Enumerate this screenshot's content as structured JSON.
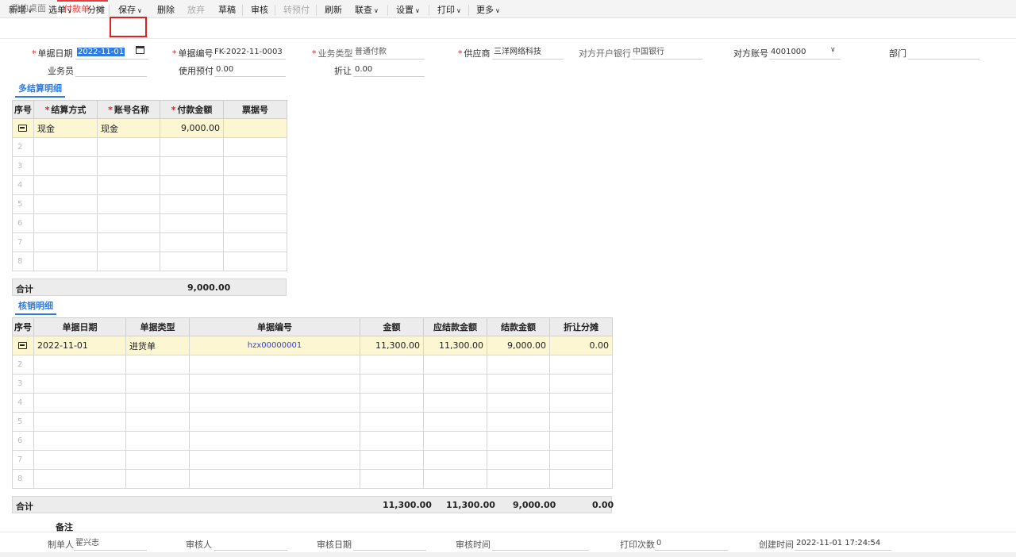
{
  "tabs": {
    "home": "我的桌面",
    "active": "付款单",
    "close": "×"
  },
  "toolbar": {
    "new": "新增",
    "select": "选单",
    "split": "分摊",
    "save": "保存",
    "delete": "删除",
    "abandon": "放弃",
    "draft": "草稿",
    "audit": "审核",
    "to_prepay": "转预付",
    "refresh": "刷新",
    "linked_query": "联查",
    "settings": "设置",
    "print": "打印",
    "more": "更多"
  },
  "form": {
    "doc_date_label": "单据日期",
    "doc_date": "2022-11-01",
    "doc_no_label": "单据编号",
    "doc_no": "FK-2022-11-0003",
    "biz_type_label": "业务类型",
    "biz_type": "普通付款",
    "supplier_label": "供应商",
    "supplier": "三洋网络科技",
    "bank_label": "对方开户银行",
    "bank": "中国银行",
    "account_label": "对方账号",
    "account": "4001000",
    "dept_label": "部门",
    "dept": "",
    "salesman_label": "业务员",
    "salesman": "",
    "prepay_label": "使用预付",
    "prepay": "0.00",
    "discount_label": "折让",
    "discount": "0.00"
  },
  "settlement": {
    "title": "多结算明细",
    "headers": {
      "idx": "序号",
      "method": "结算方式",
      "account_name": "账号名称",
      "amount": "付款金额",
      "bill_no": "票据号"
    },
    "rows": [
      {
        "method": "现金",
        "account_name": "现金",
        "amount": "9,000.00",
        "bill_no": ""
      }
    ],
    "empty_idx": [
      "2",
      "3",
      "4",
      "5",
      "6",
      "7",
      "8"
    ],
    "total_label": "合计",
    "total_amount": "9,000.00"
  },
  "writeoff": {
    "title": "核销明细",
    "headers": {
      "idx": "序号",
      "date": "单据日期",
      "type": "单据类型",
      "no": "单据编号",
      "amount": "金额",
      "due": "应结款金额",
      "settled": "结款金额",
      "discount": "折让分摊"
    },
    "rows": [
      {
        "date": "2022-11-01",
        "type": "进货单",
        "no": "hzx00000001",
        "amount": "11,300.00",
        "due": "11,300.00",
        "settled": "9,000.00",
        "discount": "0.00"
      }
    ],
    "empty_idx": [
      "2",
      "3",
      "4",
      "5",
      "6",
      "7",
      "8"
    ],
    "total_label": "合计",
    "total_amount": "11,300.00",
    "total_due": "11,300.00",
    "total_settled": "9,000.00",
    "total_discount": "0.00"
  },
  "remarks_label": "备注",
  "footer": {
    "maker_label": "制单人",
    "maker": "翟兴志",
    "auditor_label": "审核人",
    "auditor": "",
    "audit_date_label": "审核日期",
    "audit_date": "",
    "audit_time_label": "审核时间",
    "audit_time": "",
    "print_count_label": "打印次数",
    "print_count": "0",
    "created_label": "创建时间",
    "created": "2022-11-01 17:24:54"
  }
}
